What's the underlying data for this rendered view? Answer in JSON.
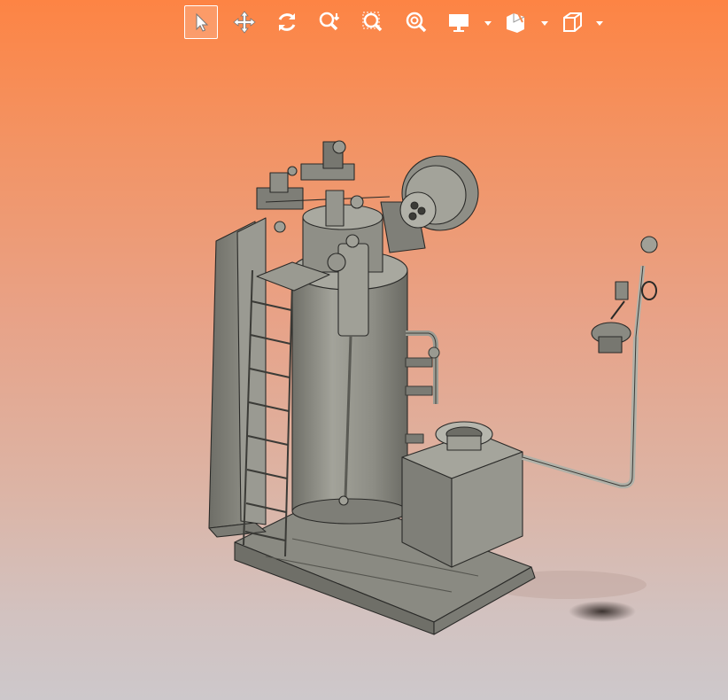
{
  "window": {
    "title": ""
  },
  "toolbar": {
    "tools": [
      {
        "id": "select",
        "icon": "cursor-arrow-icon",
        "active": true
      },
      {
        "id": "pan",
        "icon": "pan-move-icon",
        "active": false
      },
      {
        "id": "rotate",
        "icon": "rotate-icon",
        "active": false
      },
      {
        "id": "zoom",
        "icon": "zoom-icon",
        "active": false
      },
      {
        "id": "zoom-area",
        "icon": "zoom-area-icon",
        "active": false
      },
      {
        "id": "zoom-fit",
        "icon": "zoom-fit-icon",
        "active": false
      },
      {
        "id": "display",
        "icon": "display-monitor-icon",
        "active": false,
        "dropdown": true
      },
      {
        "id": "section",
        "icon": "section-view-icon",
        "active": false,
        "dropdown": true
      },
      {
        "id": "view-orientation",
        "icon": "view-cube-icon",
        "active": false,
        "dropdown": true
      }
    ]
  },
  "viewport": {
    "background_top": "#fd8444",
    "background_bottom": "#cdc8cb",
    "model": {
      "description_icon": "boiler-model"
    }
  },
  "colors": {
    "toolbar_icon": "#ffffff",
    "active_border": "#ffffff",
    "model_body": "#8e8e86",
    "model_edge": "#2a2a28"
  }
}
